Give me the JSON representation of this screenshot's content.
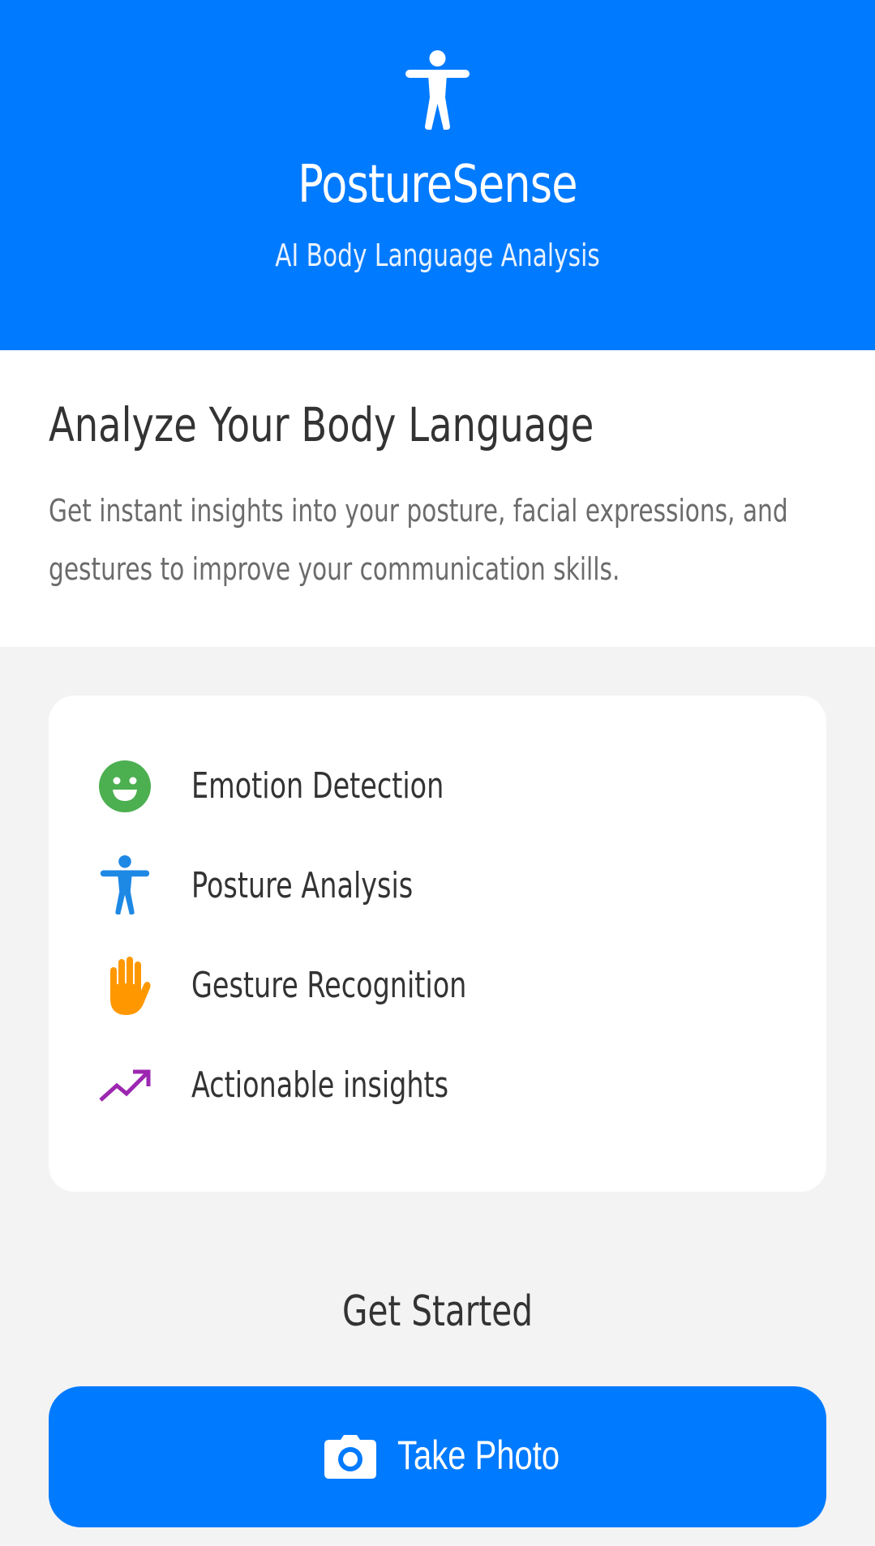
{
  "header": {
    "app_name": "PostureSense",
    "subtitle": "AI Body Language Analysis",
    "icon": "accessibility-person-icon",
    "background_color": "#007aff"
  },
  "intro": {
    "title": "Analyze Your Body Language",
    "description": "Get instant insights into your posture, facial expressions, and gestures to improve your communication skills."
  },
  "features": [
    {
      "label": "Emotion Detection",
      "icon": "smiley-face-icon",
      "color": "#4caf50"
    },
    {
      "label": "Posture Analysis",
      "icon": "accessibility-person-icon",
      "color": "#1e88e5"
    },
    {
      "label": "Gesture Recognition",
      "icon": "raised-hand-icon",
      "color": "#ff9800"
    },
    {
      "label": "Actionable insights",
      "icon": "trending-up-icon",
      "color": "#9c27b0"
    }
  ],
  "get_started": {
    "heading": "Get Started",
    "button_label": "Take Photo",
    "button_icon": "camera-icon",
    "button_color": "#007aff"
  }
}
